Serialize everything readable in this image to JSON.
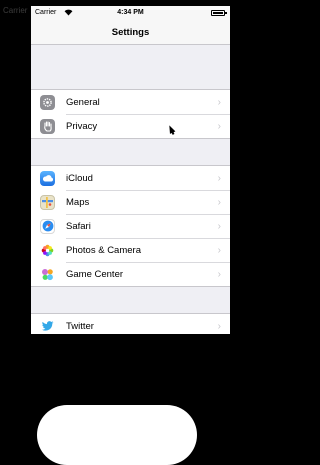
{
  "background": {
    "ghost_label": "Carrier"
  },
  "status_bar": {
    "carrier": "Carrier",
    "time": "4:34 PM"
  },
  "nav": {
    "title": "Settings"
  },
  "groups": [
    {
      "rows": [
        {
          "label": "General",
          "icon": "gear-icon",
          "color": "#8e8e93",
          "glyph": "⚙"
        },
        {
          "label": "Privacy",
          "icon": "hand-icon",
          "color": "#8e8e93",
          "glyph": "✋"
        }
      ]
    },
    {
      "rows": [
        {
          "label": "iCloud",
          "icon": "cloud-icon",
          "color": "#2d88f0",
          "glyph": "☁"
        },
        {
          "label": "Maps",
          "icon": "map-icon",
          "color": "#4fa4e8",
          "glyph": "⬚"
        },
        {
          "label": "Safari",
          "icon": "compass-icon",
          "color": "#1a86f2",
          "glyph": "✦"
        },
        {
          "label": "Photos & Camera",
          "icon": "flower-icon",
          "color": "#ffffff",
          "glyph": "✿"
        },
        {
          "label": "Game Center",
          "icon": "bubbles-icon",
          "color": "#ffffff",
          "glyph": "●"
        }
      ]
    },
    {
      "rows": [
        {
          "label": "Twitter",
          "icon": "bird-icon",
          "color": "#ffffff",
          "glyph": "✈"
        }
      ]
    }
  ]
}
